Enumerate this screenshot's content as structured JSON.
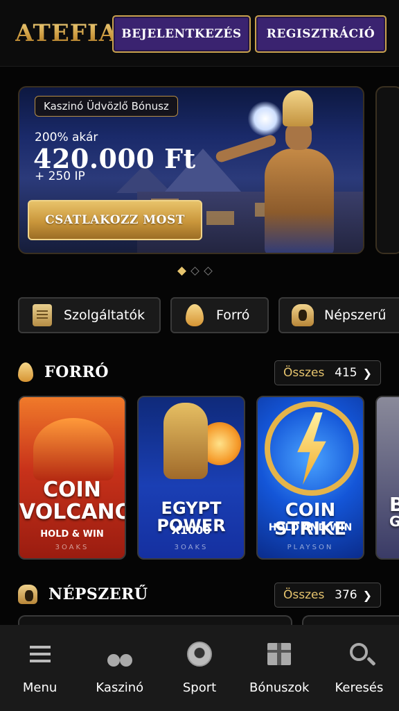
{
  "header": {
    "logo_text": "ATEFIA",
    "login_label": "BEJELENTKEZÉS",
    "register_label": "REGISZTRÁCIÓ"
  },
  "banner": {
    "badge": "Kaszinó Üdvözlő Bónusz",
    "line1": "200% akár",
    "amount": "420.000 Ft",
    "extra": "+ 250 IP",
    "cta_label": "CSATLAKOZZ MOST",
    "slides_total": 3,
    "active_slide": 1
  },
  "categories": [
    {
      "label": "Szolgáltatók",
      "icon": "scroll-icon"
    },
    {
      "label": "Forró",
      "icon": "flame-icon"
    },
    {
      "label": "Népszerű",
      "icon": "pharaoh-icon"
    }
  ],
  "sections": {
    "hot": {
      "title": "FORRÓ",
      "icon": "flame-icon",
      "all_label": "Összes",
      "count": "415",
      "games": [
        {
          "name_line1": "COIN",
          "name_line2": "VOLCANO",
          "subtitle": "HOLD & WIN",
          "provider": "3OAKS"
        },
        {
          "name_line1": "EGYPT POWER",
          "name_line2": "",
          "subtitle": "X1000",
          "provider": "3OAKS"
        },
        {
          "name_line1": "COIN STRIKE",
          "name_line2": "",
          "subtitle": "HOLD AND WIN",
          "provider": "PLAYSON"
        },
        {
          "name_line1": "B",
          "name_line2": "GO",
          "subtitle": "",
          "provider": ""
        }
      ]
    },
    "popular": {
      "title": "NÉPSZERŰ",
      "icon": "pharaoh-icon",
      "all_label": "Összes",
      "count": "376"
    }
  },
  "bottom_nav": [
    {
      "label": "Menu",
      "icon": "menu-icon"
    },
    {
      "label": "Kaszinó",
      "icon": "cherry-icon"
    },
    {
      "label": "Sport",
      "icon": "soccer-ball-icon"
    },
    {
      "label": "Bónuszok",
      "icon": "gift-icon"
    },
    {
      "label": "Keresés",
      "icon": "search-icon"
    }
  ],
  "colors": {
    "gold": "#e6c46e",
    "purple_button": "#3a2370",
    "background": "#050505"
  }
}
